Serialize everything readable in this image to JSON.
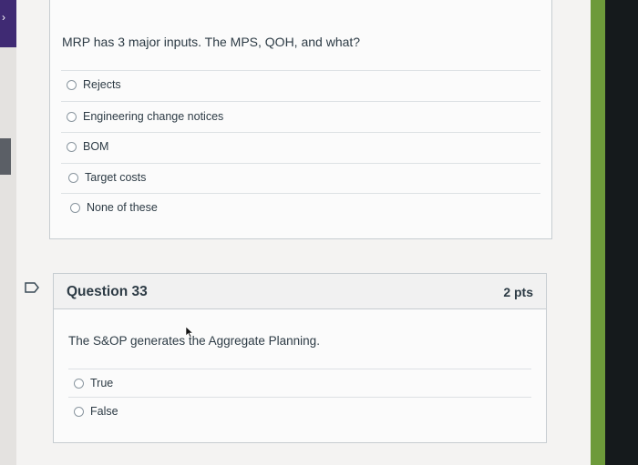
{
  "previous_question": {
    "prompt": "MRP has 3 major inputs. The MPS, QOH, and what?",
    "options": [
      "Rejects",
      "Engineering change notices",
      "BOM",
      "Target costs",
      "None of these"
    ]
  },
  "question": {
    "title": "Question 33",
    "points": "2 pts",
    "prompt": "The S&OP generates the Aggregate Planning.",
    "options": [
      "True",
      "False"
    ]
  },
  "icons": {
    "left_tab": "chevron-right-icon",
    "flag": "flag-icon",
    "cursor": "mouse-cursor-icon"
  },
  "colors": {
    "left_tab": "#3f2a73",
    "right_bar": "#6d9a3a",
    "text": "#2d3b45"
  }
}
